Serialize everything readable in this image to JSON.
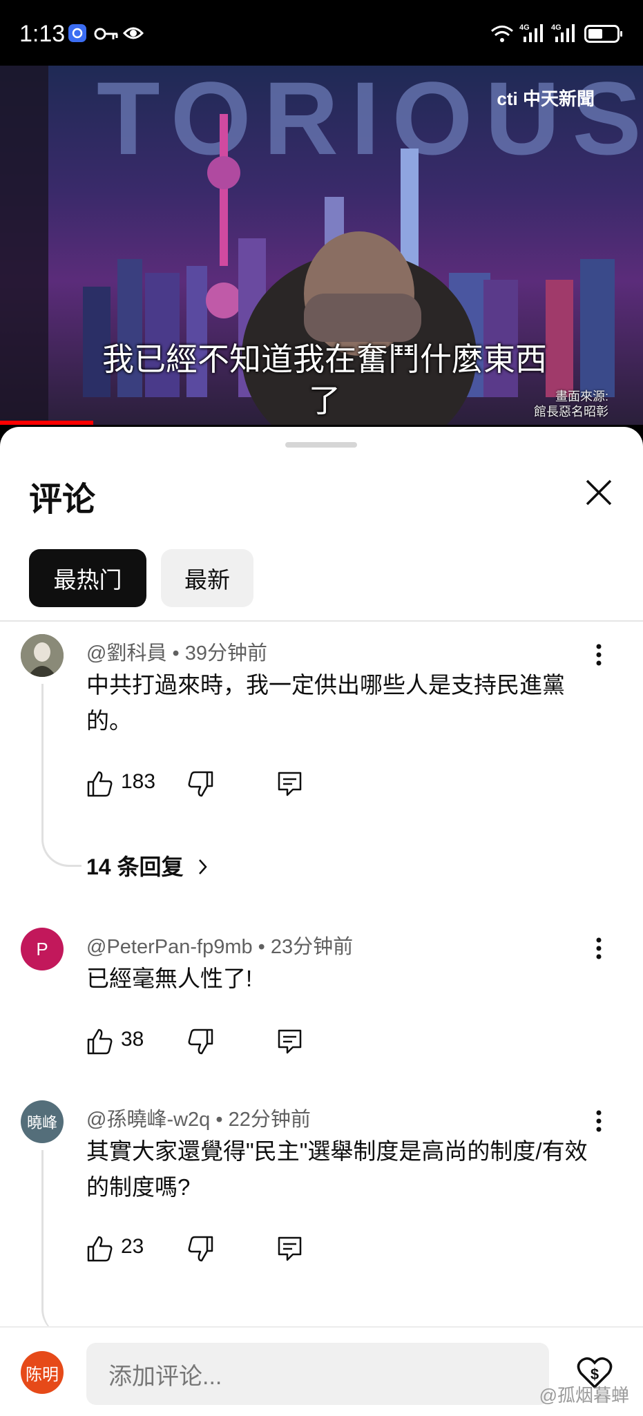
{
  "status_bar": {
    "time": "1:13",
    "network_1": "4G",
    "network_2": "4G"
  },
  "video": {
    "background_text": "TORIOUS",
    "channel_logo": "cti 中天新聞",
    "subtitle_line1": "我已經不知道我在奮鬥什麼東西",
    "subtitle_line2": "了",
    "source_line1": "畫面來源:",
    "source_line2": "館長惡名昭彰",
    "progress_fraction": 0.145
  },
  "sheet": {
    "title": "评论",
    "tabs": [
      {
        "label": "最热门",
        "active": true
      },
      {
        "label": "最新",
        "active": false
      }
    ]
  },
  "comments": [
    {
      "author": "@劉科員",
      "time": "39分钟前",
      "text": "中共打過來時，我一定供出哪些人是支持民進黨的。",
      "likes": "183",
      "avatar_color": "#6b6b5a",
      "avatar_text": "",
      "replies": "14 条回复"
    },
    {
      "author": "@PeterPan-fp9mb",
      "time": "23分钟前",
      "text": "已經毫無人性了!",
      "likes": "38",
      "avatar_color": "#c2185b",
      "avatar_text": "P",
      "replies": ""
    },
    {
      "author": "@孫曉峰-w2q",
      "time": "22分钟前",
      "text": "其實大家還覺得\"民主\"選舉制度是高尚的制度/有效的制度嗎?",
      "likes": "23",
      "avatar_color": "#546e7a",
      "avatar_text": "曉峰",
      "replies": ""
    }
  ],
  "composer": {
    "avatar_text": "陈明",
    "avatar_color": "#e64a19",
    "placeholder": "添加评论..."
  },
  "watermark": "@孤烟暮蝉"
}
